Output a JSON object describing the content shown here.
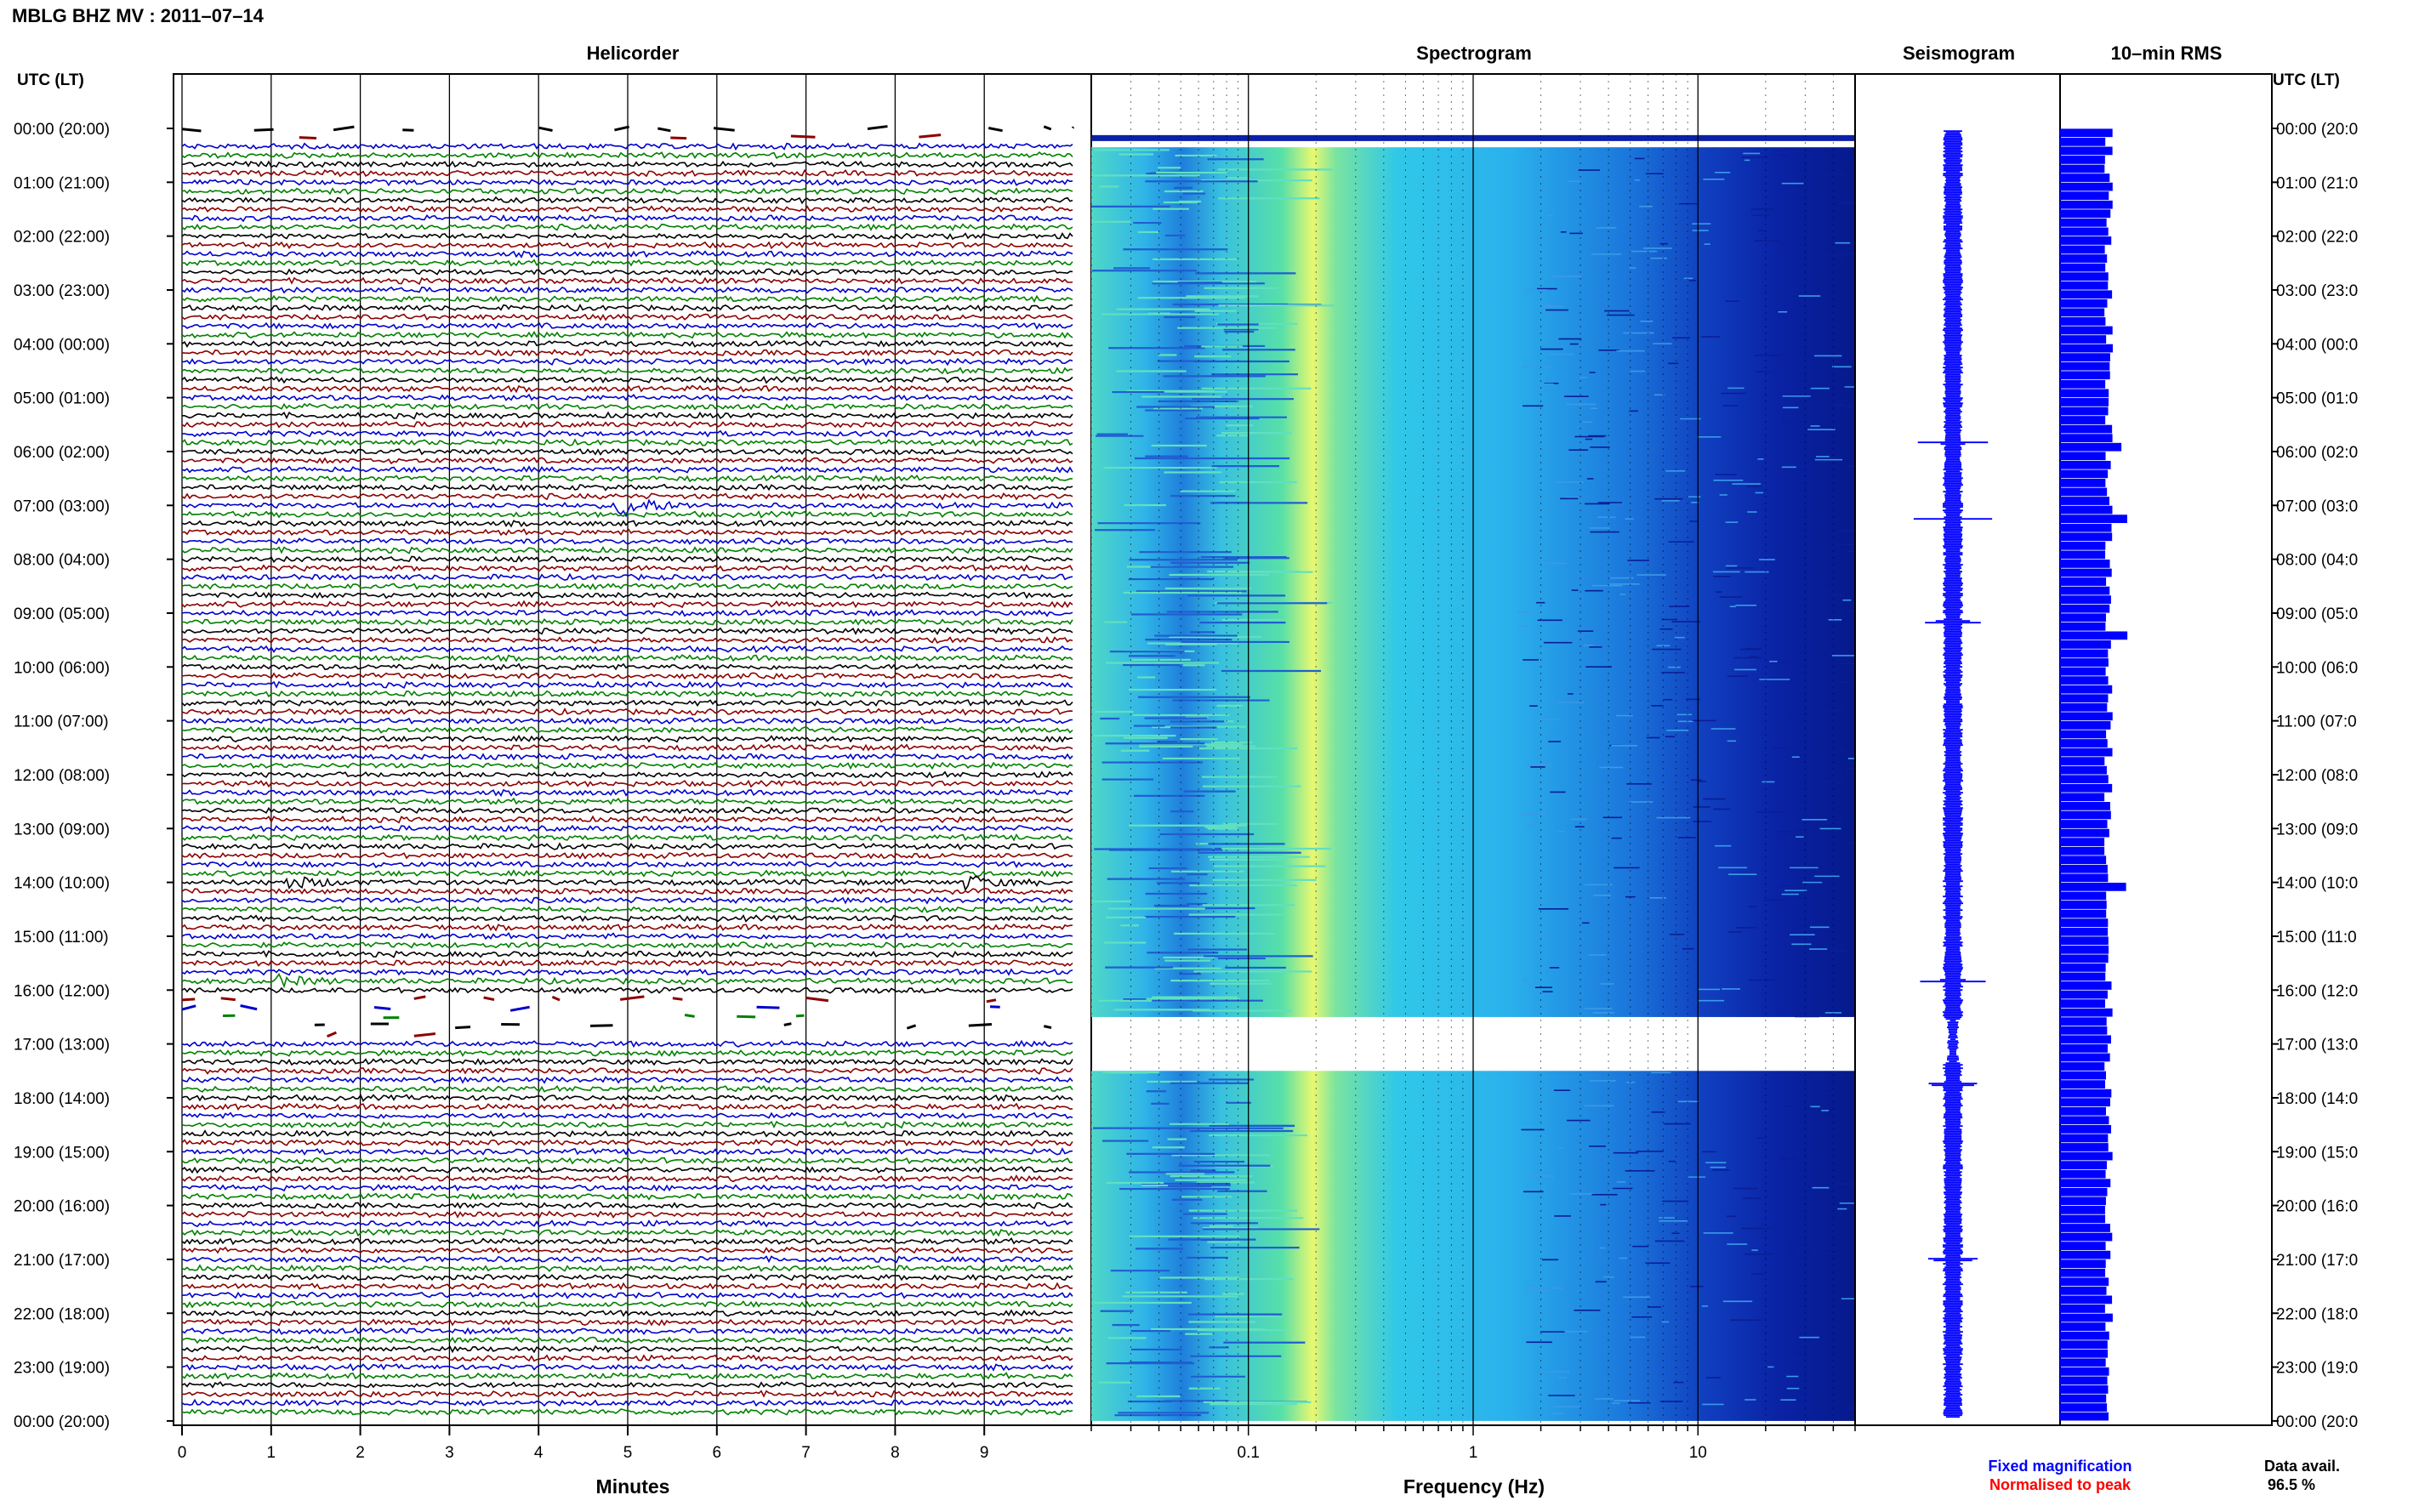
{
  "title": "MBLG BHZ MV : 2011–07–14",
  "headers": {
    "left_axis": "UTC (LT)",
    "right_axis": "UTC (LT)",
    "helicorder": "Helicorder",
    "spectrogram": "Spectrogram",
    "seismogram": "Seismogram",
    "rms": "10–min RMS"
  },
  "time_labels": [
    "00:00 (20:00)",
    "01:00 (21:00)",
    "02:00 (22:00)",
    "03:00 (23:00)",
    "04:00 (00:00)",
    "05:00 (01:00)",
    "06:00 (02:00)",
    "07:00 (03:00)",
    "08:00 (04:00)",
    "09:00 (05:00)",
    "10:00 (06:00)",
    "11:00 (07:00)",
    "12:00 (08:00)",
    "13:00 (09:00)",
    "14:00 (10:00)",
    "15:00 (11:00)",
    "16:00 (12:00)",
    "17:00 (13:00)",
    "18:00 (14:00)",
    "19:00 (15:00)",
    "20:00 (16:00)",
    "21:00 (17:00)",
    "22:00 (18:00)",
    "23:00 (19:00)",
    "00:00 (20:00)"
  ],
  "right_time_labels": [
    "00:00 (20:0",
    "01:00 (21:0",
    "02:00 (22:0",
    "03:00 (23:0",
    "04:00 (00:0",
    "05:00 (01:0",
    "06:00 (02:0",
    "07:00 (03:0",
    "08:00 (04:0",
    "09:00 (05:0",
    "10:00 (06:0",
    "11:00 (07:0",
    "12:00 (08:0",
    "13:00 (09:0",
    "14:00 (10:0",
    "15:00 (11:0",
    "16:00 (12:0",
    "17:00 (13:0",
    "18:00 (14:0",
    "19:00 (15:0",
    "20:00 (16:0",
    "21:00 (17:0",
    "22:00 (18:0",
    "23:00 (19:0",
    "00:00 (20:0"
  ],
  "footer": {
    "fixed_magnification": "Fixed magnification",
    "normalised_to_peak": "Normalised to peak",
    "data_avail_label": "Data avail.",
    "data_avail_value": "96.5 %"
  },
  "colors": {
    "trace_cycle": [
      "#000000",
      "#8b0000",
      "#0000cd",
      "#008000"
    ],
    "spectrogram_low": "#00008b",
    "spectrogram_high": "#ffff66",
    "seismogram": "#0000ff",
    "rms_bars": "#0000ff",
    "fixed_magnification_text": "#0000ff",
    "normalised_text": "#ff0000"
  },
  "chart_data": [
    {
      "type": "line",
      "title": "Helicorder",
      "xlabel": "Minutes",
      "x_ticks": [
        "0",
        "1",
        "2",
        "3",
        "4",
        "5",
        "6",
        "7",
        "8",
        "9"
      ],
      "xlim": [
        0,
        10
      ],
      "rows_per_hour": 6,
      "total_rows": 144,
      "gaps": [
        {
          "from_utc": "00:00",
          "to_utc": "00:20",
          "state": "intermittent"
        },
        {
          "from_utc": "16:10",
          "to_utc": "17:00",
          "state": "intermittent"
        }
      ],
      "events": [
        {
          "utc": "07:00",
          "minute": 4.9,
          "amplitude": "large"
        },
        {
          "utc": "14:00",
          "minute": 1.2,
          "amplitude": "moderate"
        },
        {
          "utc": "14:00",
          "minute": 8.8,
          "amplitude": "moderate"
        },
        {
          "utc": "15:50",
          "minute": 1.0,
          "amplitude": "moderate"
        }
      ]
    },
    {
      "type": "heatmap",
      "title": "Spectrogram",
      "xlabel": "Frequency (Hz)",
      "x_scale": "log",
      "x_ticks": [
        "0.1",
        "1",
        "10"
      ],
      "xlim": [
        0.02,
        50
      ],
      "dominant_band_hz": 0.25,
      "gap_utc": [
        "16:30",
        "17:30"
      ]
    },
    {
      "type": "line",
      "title": "Seismogram",
      "events_utc": [
        "05:50",
        "07:15",
        "09:10",
        "15:50",
        "17:45",
        "21:00"
      ]
    },
    {
      "type": "bar",
      "title": "10–min RMS",
      "bins_per_hour": 6,
      "peaks_utc": [
        "05:50",
        "07:10",
        "09:20",
        "14:00"
      ]
    }
  ]
}
